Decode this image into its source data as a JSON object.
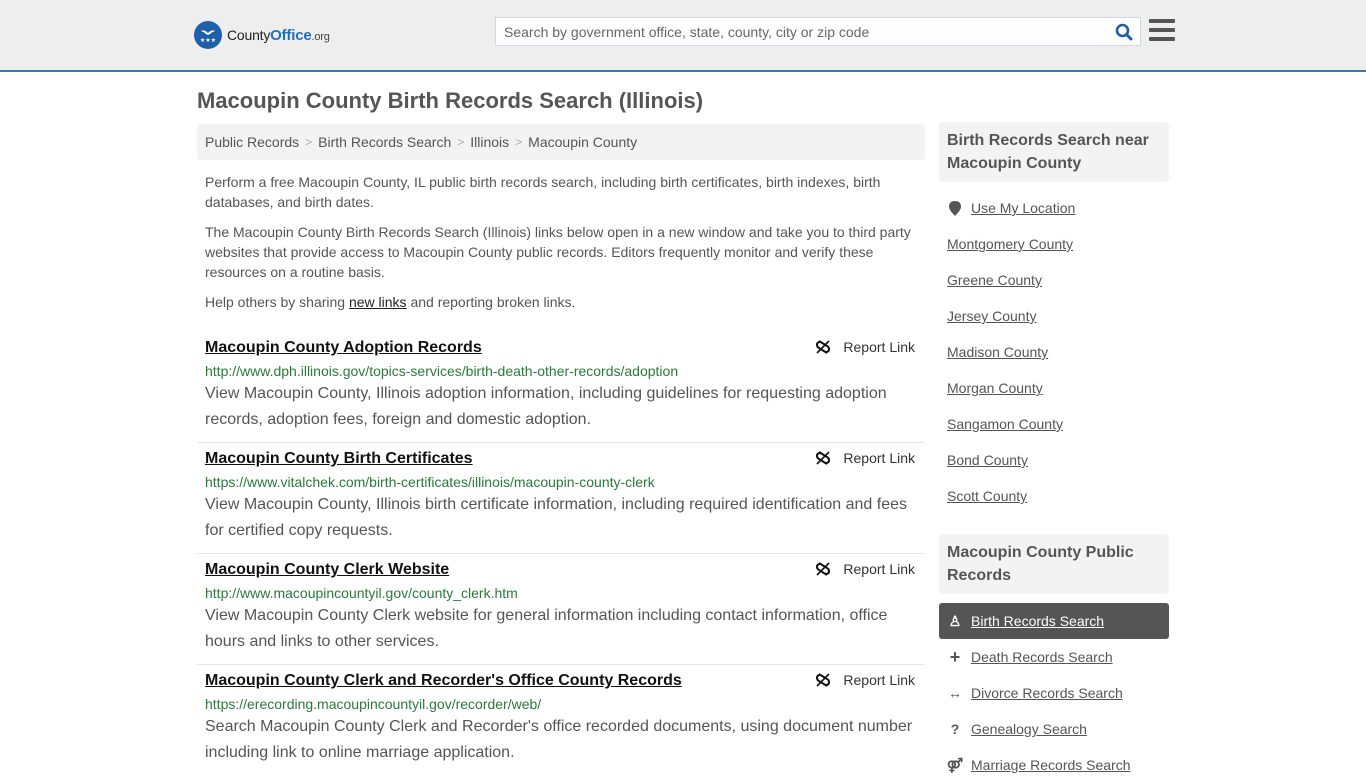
{
  "header": {
    "logo": {
      "part1": "County",
      "part2": "Office",
      "part3": ".org"
    },
    "search_placeholder": "Search by government office, state, county, city or zip code",
    "search_value": ""
  },
  "page": {
    "title": "Macoupin County Birth Records Search (Illinois)"
  },
  "breadcrumb": [
    {
      "label": "Public Records"
    },
    {
      "label": "Birth Records Search"
    },
    {
      "label": "Illinois"
    },
    {
      "label": "Macoupin County"
    }
  ],
  "intro": {
    "p1": "Perform a free Macoupin County, IL public birth records search, including birth certificates, birth indexes, birth databases, and birth dates.",
    "p2": "The Macoupin County Birth Records Search (Illinois) links below open in a new window and take you to third party websites that provide access to Macoupin County public records. Editors frequently monitor and verify these resources on a routine basis.",
    "p3_before": "Help others by sharing ",
    "p3_link": "new links",
    "p3_after": " and reporting broken links."
  },
  "report_label": "Report Link",
  "results": [
    {
      "title": "Macoupin County Adoption Records",
      "url": "http://www.dph.illinois.gov/topics-services/birth-death-other-records/adoption",
      "description": "View Macoupin County, Illinois adoption information, including guidelines for requesting adoption records, adoption fees, foreign and domestic adoption."
    },
    {
      "title": "Macoupin County Birth Certificates",
      "url": "https://www.vitalchek.com/birth-certificates/illinois/macoupin-county-clerk",
      "description": "View Macoupin County, Illinois birth certificate information, including required identification and fees for certified copy requests."
    },
    {
      "title": "Macoupin County Clerk Website",
      "url": "http://www.macoupincountyil.gov/county_clerk.htm",
      "description": "View Macoupin County Clerk website for general information including contact information, office hours and links to other services."
    },
    {
      "title": "Macoupin County Clerk and Recorder's Office County Records",
      "url": "https://erecording.macoupincountyil.gov/recorder/web/",
      "description": "Search Macoupin County Clerk and Recorder's office recorded documents, using document number including link to online marriage application."
    }
  ],
  "sidebar": {
    "nearby": {
      "heading": "Birth Records Search near Macoupin County",
      "use_location": "Use My Location",
      "counties": [
        "Montgomery County",
        "Greene County",
        "Jersey County",
        "Madison County",
        "Morgan County",
        "Sangamon County",
        "Bond County",
        "Scott County"
      ]
    },
    "public_records": {
      "heading": "Macoupin County Public Records",
      "items": [
        {
          "label": "Birth Records Search",
          "icon": "child-icon",
          "glyph": "♙",
          "active": true
        },
        {
          "label": "Death Records Search",
          "icon": "plus-icon",
          "glyph": "+",
          "active": false
        },
        {
          "label": "Divorce Records Search",
          "icon": "arrows-horizontal-icon",
          "glyph": "↔",
          "active": false
        },
        {
          "label": "Genealogy Search",
          "icon": "question-icon",
          "glyph": "?",
          "active": false
        },
        {
          "label": "Marriage Records Search",
          "icon": "marriage-icon",
          "glyph": "⚤",
          "active": false
        }
      ]
    }
  }
}
